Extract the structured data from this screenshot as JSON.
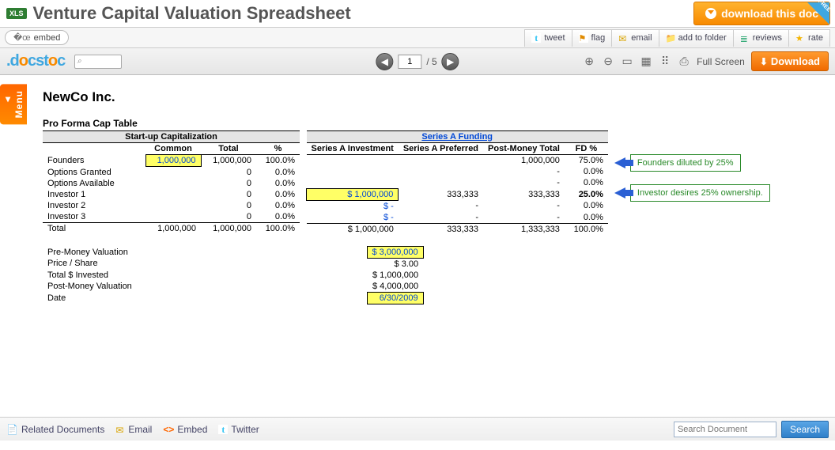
{
  "header": {
    "xls": "XLS",
    "title": "Venture Capital Valuation Spreadsheet",
    "download_doc": "download this doc",
    "free": "FREE"
  },
  "actions": {
    "embed": "embed",
    "tweet": "tweet",
    "flag": "flag",
    "email": "email",
    "add_folder": "add to folder",
    "reviews": "reviews",
    "rate": "rate"
  },
  "viewer": {
    "page_current": "1",
    "page_sep": "/ 5",
    "fullscreen": "Full Screen",
    "download": "Download"
  },
  "menu": {
    "label": "Menu"
  },
  "document": {
    "company": "NewCo Inc.",
    "subtitle": "Pro Forma Cap Table",
    "section_startup": "Start-up Capitalization",
    "section_seriesa": "Series A Funding",
    "cols_left": {
      "common": "Common",
      "total": "Total",
      "pct": "%"
    },
    "cols_right": {
      "inv": "Series A Investment",
      "pref": "Series A Preferred",
      "pm": "Post-Money Total",
      "fd": "FD %"
    },
    "rows": {
      "founders": {
        "label": "Founders",
        "common": "1,000,000",
        "total": "1,000,000",
        "pct": "100.0%",
        "inv": "",
        "pref": "",
        "pm": "1,000,000",
        "fd": "75.0%"
      },
      "opt_grant": {
        "label": "Options Granted",
        "common": "",
        "total": "0",
        "pct": "0.0%",
        "inv": "",
        "pref": "",
        "pm": "-",
        "fd": "0.0%"
      },
      "opt_avail": {
        "label": "Options Available",
        "common": "",
        "total": "0",
        "pct": "0.0%",
        "inv": "",
        "pref": "",
        "pm": "-",
        "fd": "0.0%"
      },
      "inv1": {
        "label": "Investor 1",
        "common": "",
        "total": "0",
        "pct": "0.0%",
        "inv": "$ 1,000,000",
        "pref": "333,333",
        "pm": "333,333",
        "fd": "25.0%"
      },
      "inv2": {
        "label": "Investor 2",
        "common": "",
        "total": "0",
        "pct": "0.0%",
        "inv": "$        -",
        "pref": "-",
        "pm": "-",
        "fd": "0.0%"
      },
      "inv3": {
        "label": "Investor 3",
        "common": "",
        "total": "0",
        "pct": "0.0%",
        "inv": "$        -",
        "pref": "-",
        "pm": "-",
        "fd": "0.0%"
      },
      "total": {
        "label": "Total",
        "common": "1,000,000",
        "total": "1,000,000",
        "pct": "100.0%",
        "inv": "$ 1,000,000",
        "pref": "333,333",
        "pm": "1,333,333",
        "fd": "100.0%"
      }
    },
    "valuation": {
      "premoney": {
        "label": "Pre-Money Valuation",
        "val": "$ 3,000,000"
      },
      "price": {
        "label": "Price / Share",
        "val": "$        3.00"
      },
      "invested": {
        "label": "Total $ Invested",
        "val": "$ 1,000,000"
      },
      "postmoney": {
        "label": "Post-Money Valuation",
        "val": "$ 4,000,000"
      },
      "date": {
        "label": "Date",
        "val": "6/30/2009"
      }
    },
    "annotations": {
      "a1": "Founders diluted by 25%",
      "a2": "Investor desires 25% ownership."
    }
  },
  "bottom": {
    "related": "Related Documents",
    "email": "Email",
    "embed": "Embed",
    "twitter": "Twitter",
    "search_placeholder": "Search Document",
    "search_btn": "Search"
  }
}
